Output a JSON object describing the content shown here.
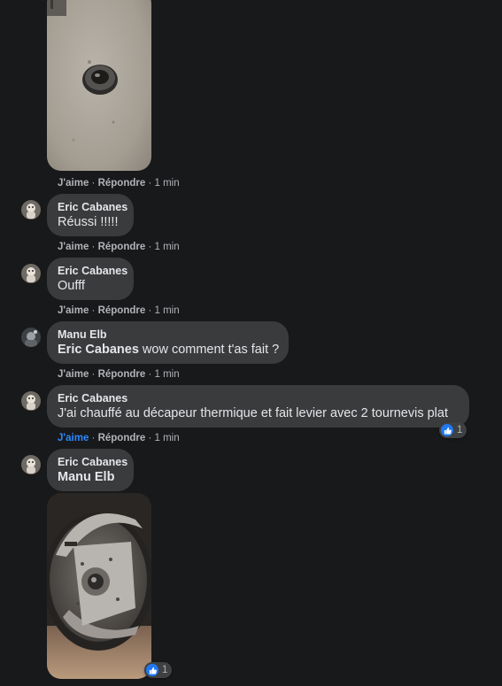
{
  "colors": {
    "background": "#18191a",
    "bubble": "#3a3b3c",
    "meta_text": "#b0b3b8",
    "like_blue": "#2d88ff"
  },
  "action_labels": {
    "like": "J'aime",
    "separator1": " · ",
    "reply": "Répondre",
    "separator2": " · ",
    "time": "1 min"
  },
  "comments": [
    {
      "author": "",
      "text": "",
      "has_photo": true,
      "photo_subject": "bearing ring on concrete"
    },
    {
      "author": "Eric Cabanes",
      "text": "Réussi !!!!!"
    },
    {
      "author": "Eric Cabanes",
      "text": "Oufff"
    },
    {
      "author": "Manu Elb",
      "mention": "Eric Cabanes",
      "text": " wow comment t'as fait ?"
    },
    {
      "author": "Eric Cabanes",
      "text": "J'ai chauffé au décapeur thermique et fait levier avec 2 tournevis plat",
      "liked": true,
      "reaction": {
        "icon": "thumbs-up-icon",
        "count": "1"
      }
    },
    {
      "author": "Eric Cabanes",
      "mention": "Manu Elb",
      "text": "",
      "has_photo": true,
      "photo_subject": "brake drum assembly",
      "reaction": {
        "icon": "thumbs-up-icon",
        "count": "1"
      }
    }
  ]
}
